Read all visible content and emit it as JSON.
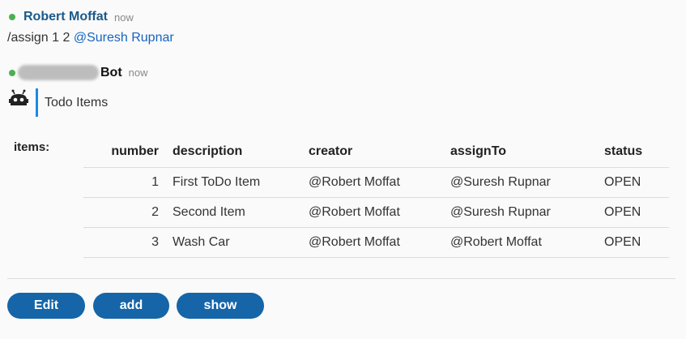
{
  "message1": {
    "author": "Robert Moffat",
    "timestamp": "now",
    "command": "/assign 1 2",
    "mention": "@Suresh Rupnar"
  },
  "message2": {
    "author_suffix": "Bot",
    "timestamp": "now",
    "title": "Todo Items",
    "items_label": "items:",
    "columns": [
      "number",
      "description",
      "creator",
      "assignTo",
      "status"
    ],
    "rows": [
      {
        "number": "1",
        "description": "First ToDo Item",
        "creator": "@Robert Moffat",
        "assignTo": "@Suresh Rupnar",
        "status": "OPEN"
      },
      {
        "number": "2",
        "description": "Second Item",
        "creator": "@Robert Moffat",
        "assignTo": "@Suresh Rupnar",
        "status": "OPEN"
      },
      {
        "number": "3",
        "description": "Wash Car",
        "creator": "@Robert Moffat",
        "assignTo": "@Robert Moffat",
        "status": "OPEN"
      }
    ],
    "buttons": [
      "Edit",
      "add",
      "show"
    ]
  },
  "colors": {
    "online": "#4caf50",
    "author": "#1a5a8a",
    "mention": "#1565c0",
    "button": "#1565a8",
    "quote_bar": "#1e88e5"
  }
}
